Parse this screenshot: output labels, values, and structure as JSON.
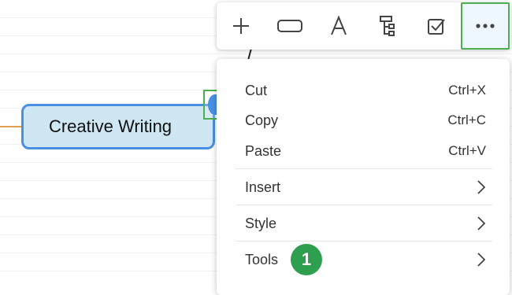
{
  "node": {
    "label": "Creative Writing"
  },
  "toolbar": {
    "buttons": [
      {
        "icon": "plus-icon"
      },
      {
        "icon": "rectangle-icon"
      },
      {
        "icon": "text-a-icon"
      },
      {
        "icon": "tree-structure-icon"
      },
      {
        "icon": "checkbox-icon"
      },
      {
        "icon": "more-icon",
        "active": true
      }
    ]
  },
  "menu": {
    "cut": {
      "label": "Cut",
      "shortcut": "Ctrl+X"
    },
    "copy": {
      "label": "Copy",
      "shortcut": "Ctrl+C"
    },
    "paste": {
      "label": "Paste",
      "shortcut": "Ctrl+V"
    },
    "insert": {
      "label": "Insert"
    },
    "style": {
      "label": "Style"
    },
    "tools": {
      "label": "Tools"
    }
  },
  "annotation": {
    "step": "1"
  },
  "colors": {
    "accent_blue": "#4a90e2",
    "node_fill": "#cfe7f3",
    "highlight_green": "#4caf50",
    "badge_green": "#2e9e4f",
    "connector_orange": "#e0a050"
  }
}
